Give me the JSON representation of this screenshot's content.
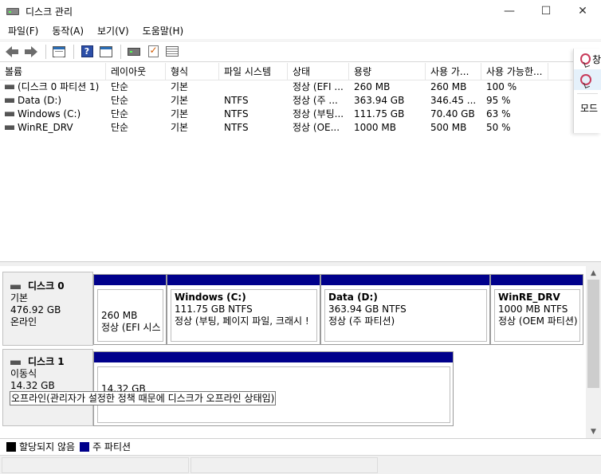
{
  "window": {
    "title": "디스크 관리",
    "minimize_glyph": "—",
    "maximize_glyph": "☐",
    "close_glyph": "✕"
  },
  "menu": [
    "파일(F)",
    "동작(A)",
    "보기(V)",
    "도움말(H)"
  ],
  "toolbar": {
    "icons": [
      "back-icon",
      "forward-icon",
      "show-hide-console-tree-icon",
      "help-icon",
      "properties-icon",
      "disk-icon",
      "checklist-icon",
      "list-icon"
    ]
  },
  "volume_list": {
    "columns": [
      "볼륨",
      "레이아웃",
      "형식",
      "파일 시스템",
      "상태",
      "용량",
      "사용 가...",
      "사용 가능한..."
    ],
    "rows": [
      [
        "(디스크 0 파티션 1)",
        "단순",
        "기본",
        "",
        "정상 (EFI ...",
        "260 MB",
        "260 MB",
        "100 %"
      ],
      [
        "Data (D:)",
        "단순",
        "기본",
        "NTFS",
        "정상 (주 ...",
        "363.94 GB",
        "346.45 ...",
        "95 %"
      ],
      [
        "Windows (C:)",
        "단순",
        "기본",
        "NTFS",
        "정상 (부팅...",
        "111.75 GB",
        "70.40 GB",
        "63 %"
      ],
      [
        "WinRE_DRV",
        "단순",
        "기본",
        "NTFS",
        "정상 (OE...",
        "1000 MB",
        "500 MB",
        "50 %"
      ]
    ]
  },
  "actions_panel": {
    "items": [
      "창",
      "",
      "모드"
    ]
  },
  "disks": [
    {
      "name": "디스크 0",
      "type": "기본",
      "size": "476.92 GB",
      "status": "온라인",
      "partitions": [
        {
          "name": "",
          "size": "260 MB",
          "status": "정상 (EFI 시스"
        },
        {
          "name": "Windows  (C:)",
          "size": "111.75 GB NTFS",
          "status": "정상 (부팅, 페이지 파일, 크래시 !"
        },
        {
          "name": "Data  (D:)",
          "size": "363.94 GB NTFS",
          "status": "정상 (주 파티션)"
        },
        {
          "name": "WinRE_DRV",
          "size": "1000 MB NTFS",
          "status": "정상 (OEM 파티션)"
        }
      ]
    },
    {
      "name": "디스크 1",
      "type": "이동식",
      "size": "14.32 GB",
      "status": "",
      "partitions": [
        {
          "name": "",
          "size": "14.32 GB",
          "status": ""
        }
      ]
    }
  ],
  "tooltip": "오프라인(관리자가 설정한 정책 때문에 디스크가 오프라인 상태임)",
  "legend": [
    {
      "label": "할당되지 않음",
      "color": "#000000"
    },
    {
      "label": "주 파티션",
      "color": "#00008b"
    }
  ],
  "colors": {
    "partition_bar": "#00008b",
    "label_bg": "#f0f0f0"
  }
}
